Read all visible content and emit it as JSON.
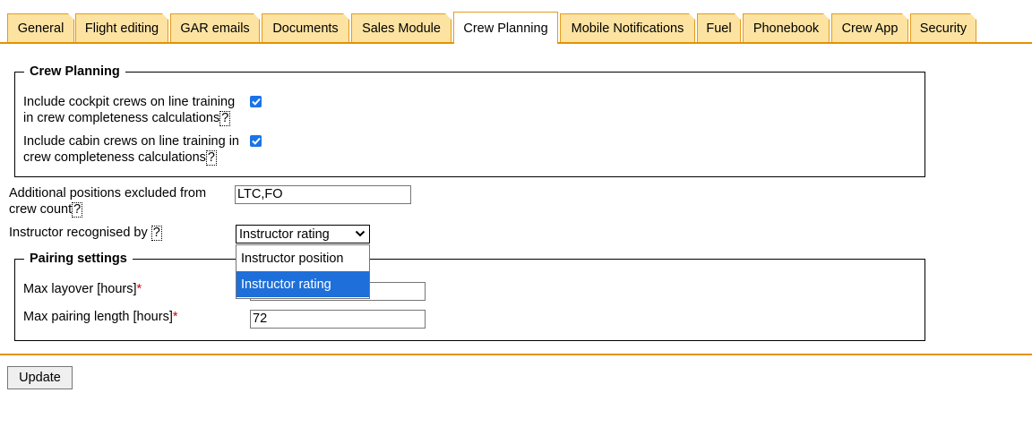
{
  "tabs": [
    {
      "label": "General",
      "active": false
    },
    {
      "label": "Flight editing",
      "active": false
    },
    {
      "label": "GAR emails",
      "active": false
    },
    {
      "label": "Documents",
      "active": false
    },
    {
      "label": "Sales Module",
      "active": false
    },
    {
      "label": "Crew Planning",
      "active": true
    },
    {
      "label": "Mobile Notifications",
      "active": false
    },
    {
      "label": "Fuel",
      "active": false
    },
    {
      "label": "Phonebook",
      "active": false
    },
    {
      "label": "Crew App",
      "active": false
    },
    {
      "label": "Security",
      "active": false
    }
  ],
  "crew_planning": {
    "legend": "Crew Planning",
    "cockpit_line1": "Include cockpit crews on line training",
    "cockpit_line2": "in crew completeness calculations",
    "cockpit_checked": true,
    "cabin_line1": "Include cabin crews on line training in",
    "cabin_line2": "crew completeness calculations",
    "cabin_checked": true,
    "help": "?"
  },
  "excluded_positions": {
    "label_line1": "Additional positions excluded from",
    "label_line2": "crew count",
    "value": "LTC,FO"
  },
  "instructor": {
    "label": "Instructor recognised by",
    "selected": "Instructor rating",
    "options": [
      "Instructor position",
      "Instructor rating"
    ]
  },
  "pairing": {
    "legend": "Pairing settings",
    "max_layover_label": "Max layover [hours]",
    "max_layover_value": "",
    "max_pairing_label": "Max pairing length [hours]",
    "max_pairing_value": "72",
    "required_mark": "*"
  },
  "update_button": "Update",
  "colors": {
    "tab_bg": "#fde3a1",
    "tab_border": "#e39a1f",
    "accent_line": "#e39200",
    "checkbox": "#1a73e8",
    "selected_option": "#1e6fd9"
  }
}
